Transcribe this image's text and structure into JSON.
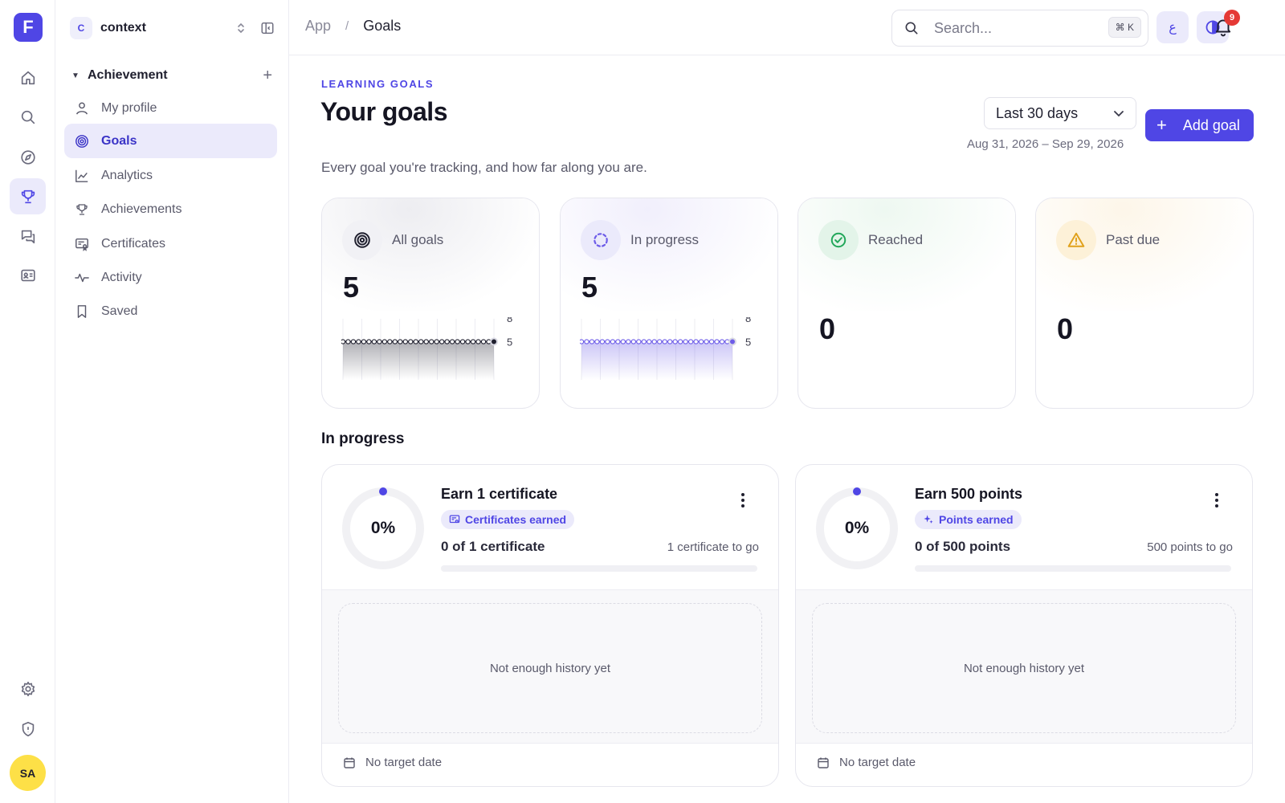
{
  "rail": {
    "logo_letter": "F",
    "items": [
      {
        "name": "home-icon",
        "active": false
      },
      {
        "name": "search-icon",
        "active": false
      },
      {
        "name": "compass-icon",
        "active": false
      },
      {
        "name": "trophy-icon",
        "active": true
      },
      {
        "name": "chat-icon",
        "active": false
      },
      {
        "name": "id-card-icon",
        "active": false
      }
    ],
    "bottom_items": [
      "gear-icon",
      "shield-icon"
    ],
    "avatar_initials": "SA"
  },
  "workspace": {
    "badge": "C",
    "name": "context"
  },
  "sidebar": {
    "section_label": "Achievement",
    "items": [
      {
        "label": "My profile",
        "icon": "user-icon",
        "active": false
      },
      {
        "label": "Goals",
        "icon": "target-icon",
        "active": true
      },
      {
        "label": "Analytics",
        "icon": "chart-icon",
        "active": false
      },
      {
        "label": "Achievements",
        "icon": "trophy-icon",
        "active": false
      },
      {
        "label": "Certificates",
        "icon": "certificate-icon",
        "active": false
      },
      {
        "label": "Activity",
        "icon": "activity-icon",
        "active": false
      },
      {
        "label": "Saved",
        "icon": "bookmark-icon",
        "active": false
      }
    ]
  },
  "topbar": {
    "breadcrumb": {
      "root": "App",
      "separator": "/",
      "current": "Goals"
    },
    "search": {
      "placeholder": "Search...",
      "shortcut": "⌘ K"
    },
    "lang_button": "ع",
    "notifications_count": "9"
  },
  "header": {
    "eyebrow": "LEARNING GOALS",
    "title": "Your goals",
    "subtitle": "Every goal you're tracking, and how far along you are.",
    "range_select": "Last 30 days",
    "range_dates": "Aug 31, 2026 – Sep 29, 2026",
    "add_button": "Add goal"
  },
  "stats": [
    {
      "label": "All goals",
      "value": "5",
      "icon": "target-icon",
      "color": "#1f1f2e",
      "spark_max": "8",
      "spark_last": "5",
      "spark_values": [
        5,
        5,
        5,
        5,
        5,
        5,
        5,
        5,
        5,
        5,
        5,
        5,
        5,
        5,
        5,
        5,
        5,
        5,
        5,
        5,
        5,
        5,
        5,
        5,
        5,
        5,
        5,
        5,
        5,
        5
      ]
    },
    {
      "label": "In progress",
      "value": "5",
      "icon": "loader-icon",
      "color": "#6d5ce8",
      "spark_max": "8",
      "spark_last": "5",
      "spark_values": [
        5,
        5,
        5,
        5,
        5,
        5,
        5,
        5,
        5,
        5,
        5,
        5,
        5,
        5,
        5,
        5,
        5,
        5,
        5,
        5,
        5,
        5,
        5,
        5,
        5,
        5,
        5,
        5,
        5,
        5
      ]
    },
    {
      "label": "Reached",
      "value": "0",
      "icon": "check-circle-icon",
      "color": "#22a75a"
    },
    {
      "label": "Past due",
      "value": "0",
      "icon": "warning-icon",
      "color": "#e0a11b"
    }
  ],
  "section_title": "In progress",
  "goals": [
    {
      "title": "Earn 1 certificate",
      "tag": "Certificates earned",
      "tag_icon": "certificate-icon",
      "percent": "0%",
      "progress_text": "0 of 1 certificate",
      "to_go": "1 certificate to go",
      "progress": 0,
      "history_text": "Not enough history yet",
      "target_text": "No target date"
    },
    {
      "title": "Earn 500 points",
      "tag": "Points earned",
      "tag_icon": "sparkle-icon",
      "percent": "0%",
      "progress_text": "0 of 500 points",
      "to_go": "500 points to go",
      "progress": 0,
      "history_text": "Not enough history yet",
      "target_text": "No target date"
    }
  ],
  "colors": {
    "accent": "#4f46e5",
    "accent_soft": "#ebeafb",
    "danger": "#e53935"
  }
}
